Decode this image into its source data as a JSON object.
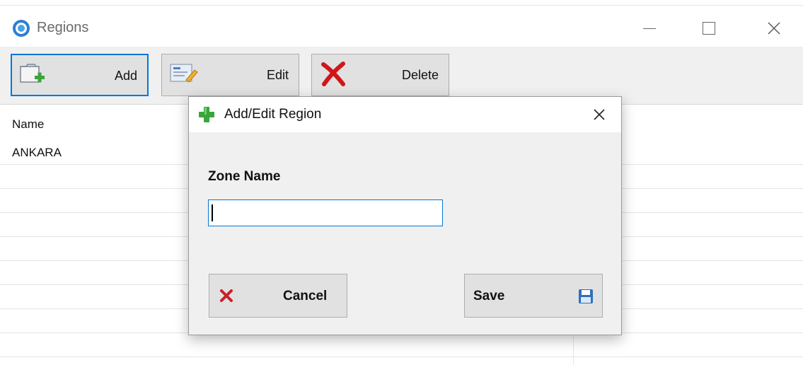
{
  "window": {
    "title": "Regions",
    "icons": {
      "app": "app-circle-icon",
      "minimize": "minimize-icon",
      "maximize": "maximize-icon",
      "close": "close-icon"
    }
  },
  "toolbar": {
    "add_label": "Add",
    "edit_label": "Edit",
    "delete_label": "Delete",
    "icons": {
      "add": "folder-add-icon",
      "edit": "edit-form-icon",
      "delete": "red-x-icon"
    }
  },
  "list": {
    "column_header": "Name",
    "rows": [
      "ANKARA"
    ]
  },
  "dialog": {
    "title": "Add/Edit Region",
    "field_label": "Zone Name",
    "field_value": "",
    "cancel_label": "Cancel",
    "save_label": "Save",
    "icons": {
      "title": "green-plus-icon",
      "close": "close-icon",
      "cancel": "red-x-icon",
      "save": "floppy-disk-icon"
    }
  },
  "colors": {
    "accent": "#0078d7",
    "button_face": "#e1e1e1",
    "dialog_bg": "#f0f0f0",
    "plus_green": "#3aa53a",
    "delete_red": "#d0161b"
  }
}
